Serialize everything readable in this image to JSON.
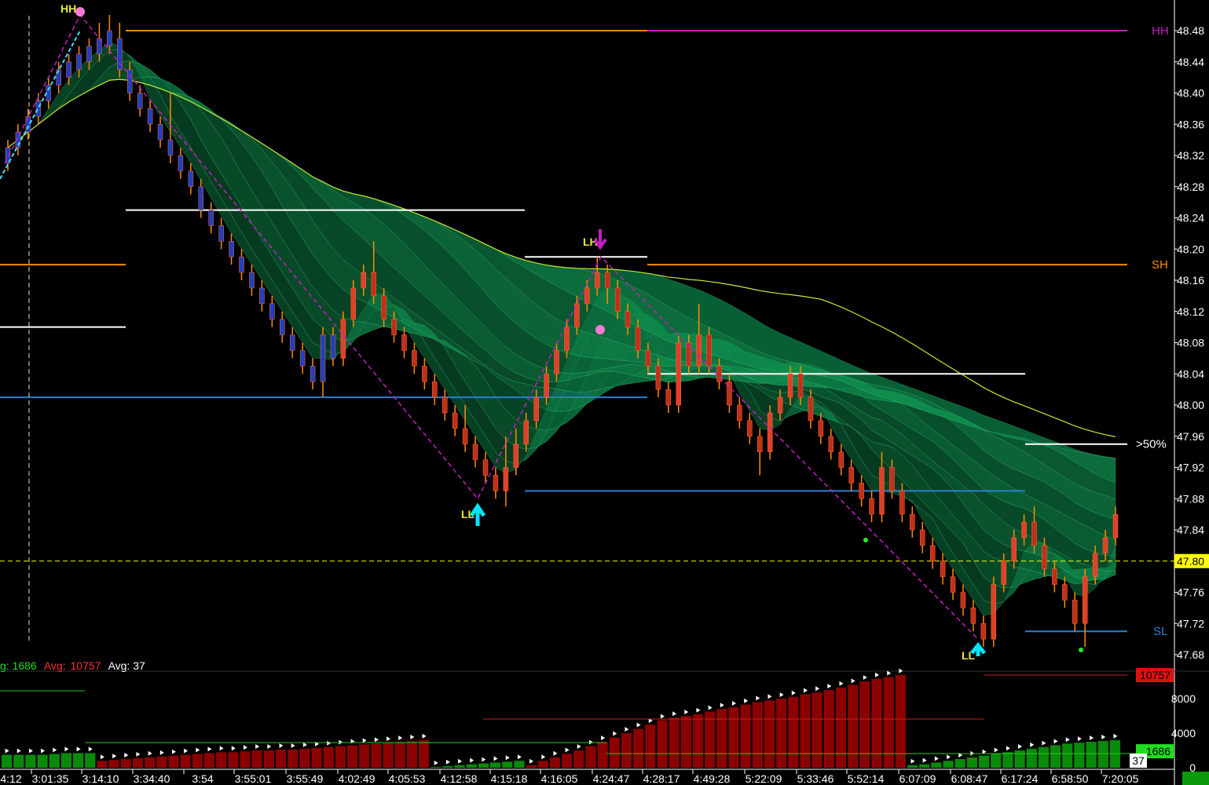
{
  "colors": {
    "background": "#000000",
    "bear_candle": "#c0301a",
    "bull_candle": "#2040c0",
    "wick": "#ff8c00",
    "ribbon": "#0f8f50",
    "ribbon_dark": "#0a6a3a",
    "hh_line": "#c020c0",
    "sh_line": "#ff8c00",
    "sl_line": "#2a7fd5",
    "support_white": "#ffffff",
    "zigzag": "#c020c0",
    "price_marker": "#ffff00",
    "vol_up": "#0a8a0a",
    "vol_down": "#8b0000",
    "cyan_arrow": "#00e5ff"
  },
  "chart_data": {
    "type": "candlestick",
    "price_axis": {
      "ylim": [
        47.66,
        48.5
      ],
      "ticks": [
        "48.48",
        "48.44",
        "48.40",
        "48.36",
        "48.32",
        "48.28",
        "48.24",
        "48.20",
        "48.16",
        "48.12",
        "48.08",
        "48.04",
        "48.00",
        "47.96",
        "47.92",
        "47.88",
        "47.84",
        "47.80",
        "47.76",
        "47.72",
        "47.68"
      ],
      "current_price": "47.80"
    },
    "time_axis": {
      "labels": [
        "4:12",
        "3:01:35",
        "3:14:10",
        "3:34:40",
        "3:54",
        "3:55:01",
        "3:55:49",
        "4:02:49",
        "4:05:53",
        "4:12:58",
        "4:15:18",
        "4:16:05",
        "4:24:47",
        "4:28:17",
        "4:49:28",
        "5:22:09",
        "5:33:46",
        "5:52:14",
        "6:07:09",
        "6:08:47",
        "6:17:24",
        "6:58:50",
        "7:20:05"
      ]
    },
    "levels": [
      {
        "label": "HH",
        "value": 48.48
      },
      {
        "label": "SH",
        "value": 48.18
      },
      {
        "label": ">50%",
        "value": 47.95
      },
      {
        "label": "SL",
        "value": 47.71
      }
    ],
    "swings": [
      {
        "label": "HH",
        "value": 48.5
      },
      {
        "label": "LH",
        "value": 48.19
      },
      {
        "label": "LL",
        "value": 47.88
      },
      {
        "label": "LL",
        "value": 47.7
      }
    ],
    "candles": [
      [
        48.31,
        48.33,
        48.34,
        48.3
      ],
      [
        48.33,
        48.35,
        48.36,
        48.32
      ],
      [
        48.35,
        48.37,
        48.38,
        48.34
      ],
      [
        48.37,
        48.39,
        48.4,
        48.36
      ],
      [
        48.39,
        48.41,
        48.42,
        48.38
      ],
      [
        48.41,
        48.43,
        48.44,
        48.4
      ],
      [
        48.42,
        48.44,
        48.45,
        48.41
      ],
      [
        48.43,
        48.45,
        48.46,
        48.42
      ],
      [
        48.44,
        48.46,
        48.47,
        48.43
      ],
      [
        48.45,
        48.47,
        48.49,
        48.44
      ],
      [
        48.46,
        48.48,
        48.5,
        48.45
      ],
      [
        48.47,
        48.43,
        48.49,
        48.42
      ],
      [
        48.43,
        48.4,
        48.44,
        48.39
      ],
      [
        48.4,
        48.38,
        48.41,
        48.37
      ],
      [
        48.38,
        48.36,
        48.39,
        48.35
      ],
      [
        48.36,
        48.34,
        48.37,
        48.33
      ],
      [
        48.34,
        48.32,
        48.4,
        48.31
      ],
      [
        48.32,
        48.3,
        48.33,
        48.29
      ],
      [
        48.3,
        48.28,
        48.31,
        48.27
      ],
      [
        48.28,
        48.25,
        48.29,
        48.24
      ],
      [
        48.25,
        48.23,
        48.26,
        48.22
      ],
      [
        48.23,
        48.21,
        48.24,
        48.2
      ],
      [
        48.21,
        48.19,
        48.22,
        48.18
      ],
      [
        48.19,
        48.17,
        48.2,
        48.16
      ],
      [
        48.17,
        48.15,
        48.18,
        48.14
      ],
      [
        48.15,
        48.13,
        48.16,
        48.12
      ],
      [
        48.13,
        48.11,
        48.14,
        48.1
      ],
      [
        48.11,
        48.09,
        48.12,
        48.08
      ],
      [
        48.09,
        48.07,
        48.1,
        48.06
      ],
      [
        48.07,
        48.05,
        48.08,
        48.04
      ],
      [
        48.05,
        48.03,
        48.06,
        48.02
      ],
      [
        48.03,
        48.09,
        48.1,
        48.01
      ],
      [
        48.09,
        48.06,
        48.1,
        48.05
      ],
      [
        48.06,
        48.11,
        48.12,
        48.05
      ],
      [
        48.11,
        48.15,
        48.16,
        48.1
      ],
      [
        48.15,
        48.17,
        48.18,
        48.14
      ],
      [
        48.17,
        48.14,
        48.21,
        48.13
      ],
      [
        48.14,
        48.11,
        48.15,
        48.1
      ],
      [
        48.11,
        48.09,
        48.12,
        48.08
      ],
      [
        48.09,
        48.07,
        48.1,
        48.06
      ],
      [
        48.07,
        48.05,
        48.08,
        48.04
      ],
      [
        48.05,
        48.03,
        48.06,
        48.02
      ],
      [
        48.03,
        48.01,
        48.04,
        48.0
      ],
      [
        48.01,
        47.99,
        48.02,
        47.98
      ],
      [
        47.99,
        47.97,
        48.0,
        47.96
      ],
      [
        47.97,
        47.95,
        48.0,
        47.94
      ],
      [
        47.95,
        47.93,
        47.96,
        47.92
      ],
      [
        47.93,
        47.91,
        47.94,
        47.9
      ],
      [
        47.91,
        47.89,
        47.92,
        47.88
      ],
      [
        47.89,
        47.92,
        47.96,
        47.87
      ],
      [
        47.92,
        47.95,
        47.97,
        47.91
      ],
      [
        47.95,
        47.98,
        47.99,
        47.94
      ],
      [
        47.98,
        48.01,
        48.02,
        47.97
      ],
      [
        48.01,
        48.04,
        48.05,
        48.0
      ],
      [
        48.04,
        48.07,
        48.08,
        48.03
      ],
      [
        48.07,
        48.1,
        48.11,
        48.06
      ],
      [
        48.1,
        48.13,
        48.14,
        48.09
      ],
      [
        48.13,
        48.15,
        48.16,
        48.12
      ],
      [
        48.15,
        48.17,
        48.19,
        48.14
      ],
      [
        48.17,
        48.15,
        48.18,
        48.13
      ],
      [
        48.15,
        48.12,
        48.16,
        48.11
      ],
      [
        48.12,
        48.1,
        48.13,
        48.09
      ],
      [
        48.1,
        48.07,
        48.11,
        48.06
      ],
      [
        48.07,
        48.05,
        48.08,
        48.04
      ],
      [
        48.05,
        48.02,
        48.06,
        48.01
      ],
      [
        48.02,
        48.0,
        48.03,
        47.99
      ],
      [
        48.0,
        48.08,
        48.09,
        47.99
      ],
      [
        48.08,
        48.05,
        48.09,
        48.04
      ],
      [
        48.05,
        48.09,
        48.13,
        48.04
      ],
      [
        48.09,
        48.05,
        48.1,
        48.04
      ],
      [
        48.05,
        48.03,
        48.06,
        48.02
      ],
      [
        48.03,
        48.0,
        48.04,
        47.99
      ],
      [
        48.0,
        47.98,
        48.01,
        47.97
      ],
      [
        47.98,
        47.96,
        47.99,
        47.95
      ],
      [
        47.96,
        47.94,
        47.97,
        47.91
      ],
      [
        47.94,
        47.99,
        48.0,
        47.93
      ],
      [
        47.99,
        48.01,
        48.02,
        47.98
      ],
      [
        48.01,
        48.04,
        48.05,
        48.0
      ],
      [
        48.04,
        48.01,
        48.05,
        48.0
      ],
      [
        48.01,
        47.98,
        48.02,
        47.97
      ],
      [
        47.98,
        47.96,
        47.99,
        47.95
      ],
      [
        47.96,
        47.94,
        47.97,
        47.93
      ],
      [
        47.94,
        47.92,
        47.95,
        47.91
      ],
      [
        47.92,
        47.9,
        47.93,
        47.89
      ],
      [
        47.9,
        47.88,
        47.91,
        47.87
      ],
      [
        47.88,
        47.86,
        47.89,
        47.85
      ],
      [
        47.86,
        47.92,
        47.94,
        47.85
      ],
      [
        47.92,
        47.89,
        47.93,
        47.88
      ],
      [
        47.89,
        47.86,
        47.9,
        47.85
      ],
      [
        47.86,
        47.84,
        47.87,
        47.83
      ],
      [
        47.84,
        47.82,
        47.85,
        47.81
      ],
      [
        47.82,
        47.8,
        47.83,
        47.79
      ],
      [
        47.8,
        47.78,
        47.81,
        47.77
      ],
      [
        47.78,
        47.76,
        47.79,
        47.75
      ],
      [
        47.76,
        47.74,
        47.77,
        47.73
      ],
      [
        47.74,
        47.72,
        47.75,
        47.71
      ],
      [
        47.72,
        47.7,
        47.73,
        47.69
      ],
      [
        47.7,
        47.77,
        47.78,
        47.69
      ],
      [
        47.77,
        47.8,
        47.81,
        47.76
      ],
      [
        47.8,
        47.83,
        47.84,
        47.79
      ],
      [
        47.83,
        47.85,
        47.86,
        47.82
      ],
      [
        47.85,
        47.82,
        47.87,
        47.81
      ],
      [
        47.82,
        47.79,
        47.83,
        47.78
      ],
      [
        47.79,
        47.77,
        47.8,
        47.76
      ],
      [
        47.77,
        47.75,
        47.78,
        47.74
      ],
      [
        47.75,
        47.72,
        47.76,
        47.71
      ],
      [
        47.72,
        47.78,
        47.79,
        47.69
      ],
      [
        47.78,
        47.81,
        47.82,
        47.77
      ],
      [
        47.81,
        47.83,
        47.84,
        47.8
      ],
      [
        47.83,
        47.86,
        47.87,
        47.82
      ]
    ],
    "volume": {
      "legend": {
        "avg_up": "g: 1686",
        "avg_down_label": "Avg:",
        "avg_down": "10757",
        "avg_neutral": "Avg: 37"
      },
      "ticks": [
        "8000",
        "4000",
        "0"
      ],
      "tags": [
        "10757",
        "1686",
        "37"
      ],
      "bars": [
        [
          1,
          1500
        ],
        [
          1,
          1500
        ],
        [
          1,
          1500
        ],
        [
          1,
          1500
        ],
        [
          1,
          1600
        ],
        [
          1,
          1700
        ],
        [
          1,
          1700
        ],
        [
          1,
          1700
        ],
        [
          -1,
          800
        ],
        [
          -1,
          900
        ],
        [
          -1,
          1000
        ],
        [
          -1,
          1100
        ],
        [
          -1,
          1200
        ],
        [
          -1,
          1300
        ],
        [
          -1,
          1400
        ],
        [
          -1,
          1500
        ],
        [
          -1,
          1600
        ],
        [
          -1,
          1700
        ],
        [
          -1,
          1800
        ],
        [
          -1,
          1800
        ],
        [
          -1,
          1900
        ],
        [
          -1,
          2000
        ],
        [
          -1,
          2000
        ],
        [
          -1,
          2100
        ],
        [
          -1,
          2100
        ],
        [
          -1,
          2200
        ],
        [
          -1,
          2300
        ],
        [
          -1,
          2400
        ],
        [
          -1,
          2500
        ],
        [
          -1,
          2600
        ],
        [
          -1,
          2700
        ],
        [
          -1,
          2800
        ],
        [
          -1,
          2900
        ],
        [
          -1,
          3000
        ],
        [
          -1,
          3100
        ],
        [
          -1,
          3200
        ],
        [
          1,
          100
        ],
        [
          1,
          200
        ],
        [
          1,
          300
        ],
        [
          1,
          400
        ],
        [
          1,
          500
        ],
        [
          1,
          600
        ],
        [
          1,
          700
        ],
        [
          1,
          800
        ],
        [
          -1,
          300
        ],
        [
          -1,
          800
        ],
        [
          -1,
          1200
        ],
        [
          -1,
          1600
        ],
        [
          -1,
          2000
        ],
        [
          -1,
          2500
        ],
        [
          -1,
          3000
        ],
        [
          -1,
          3500
        ],
        [
          -1,
          4000
        ],
        [
          -1,
          4500
        ],
        [
          -1,
          5000
        ],
        [
          -1,
          5500
        ],
        [
          -1,
          5800
        ],
        [
          -1,
          6000
        ],
        [
          -1,
          6200
        ],
        [
          -1,
          6500
        ],
        [
          -1,
          6800
        ],
        [
          -1,
          7000
        ],
        [
          -1,
          7300
        ],
        [
          -1,
          7600
        ],
        [
          -1,
          7800
        ],
        [
          -1,
          8000
        ],
        [
          -1,
          8200
        ],
        [
          -1,
          8500
        ],
        [
          -1,
          8700
        ],
        [
          -1,
          9000
        ],
        [
          -1,
          9300
        ],
        [
          -1,
          9600
        ],
        [
          -1,
          10000
        ],
        [
          -1,
          10300
        ],
        [
          -1,
          10500
        ],
        [
          -1,
          10757
        ],
        [
          1,
          300
        ],
        [
          1,
          400
        ],
        [
          1,
          600
        ],
        [
          1,
          800
        ],
        [
          1,
          1000
        ],
        [
          1,
          1200
        ],
        [
          1,
          1400
        ],
        [
          1,
          1600
        ],
        [
          1,
          1800
        ],
        [
          1,
          2000
        ],
        [
          1,
          2200
        ],
        [
          1,
          2400
        ],
        [
          1,
          2600
        ],
        [
          1,
          2800
        ],
        [
          1,
          2900
        ],
        [
          1,
          3000
        ],
        [
          1,
          3100
        ],
        [
          1,
          3200
        ]
      ]
    }
  }
}
